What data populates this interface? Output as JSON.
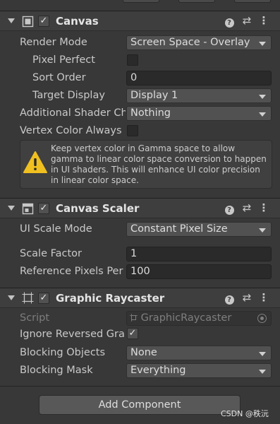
{
  "canvas": {
    "title": "Canvas",
    "render_mode_label": "Render Mode",
    "render_mode_value": "Screen Space - Overlay",
    "pixel_perfect_label": "Pixel Perfect",
    "sort_order_label": "Sort Order",
    "sort_order_value": "0",
    "target_display_label": "Target Display",
    "target_display_value": "Display 1",
    "additional_shader_label": "Additional Shader Ch",
    "additional_shader_value": "Nothing",
    "vertex_color_label": "Vertex Color Always",
    "warning_text": "Keep vertex color in Gamma space to allow gamma to linear color space conversion to happen in UI shaders. This will enhance UI color precision in linear color space."
  },
  "canvas_scaler": {
    "title": "Canvas Scaler",
    "ui_scale_mode_label": "UI Scale Mode",
    "ui_scale_mode_value": "Constant Pixel Size",
    "scale_factor_label": "Scale Factor",
    "scale_factor_value": "1",
    "ref_pixels_label": "Reference Pixels Per",
    "ref_pixels_value": "100"
  },
  "graphic_raycaster": {
    "title": "Graphic Raycaster",
    "script_label": "Script",
    "script_value": "GraphicRaycaster",
    "ignore_reversed_label": "Ignore Reversed Grap",
    "blocking_objects_label": "Blocking Objects",
    "blocking_objects_value": "None",
    "blocking_mask_label": "Blocking Mask",
    "blocking_mask_value": "Everything"
  },
  "footer": {
    "add_component_label": "Add Component",
    "watermark": "CSDN @秩沅"
  },
  "icons": {
    "help": "?",
    "presets": "⇄",
    "menu": "⋮",
    "check": "✓",
    "warning": "!"
  }
}
